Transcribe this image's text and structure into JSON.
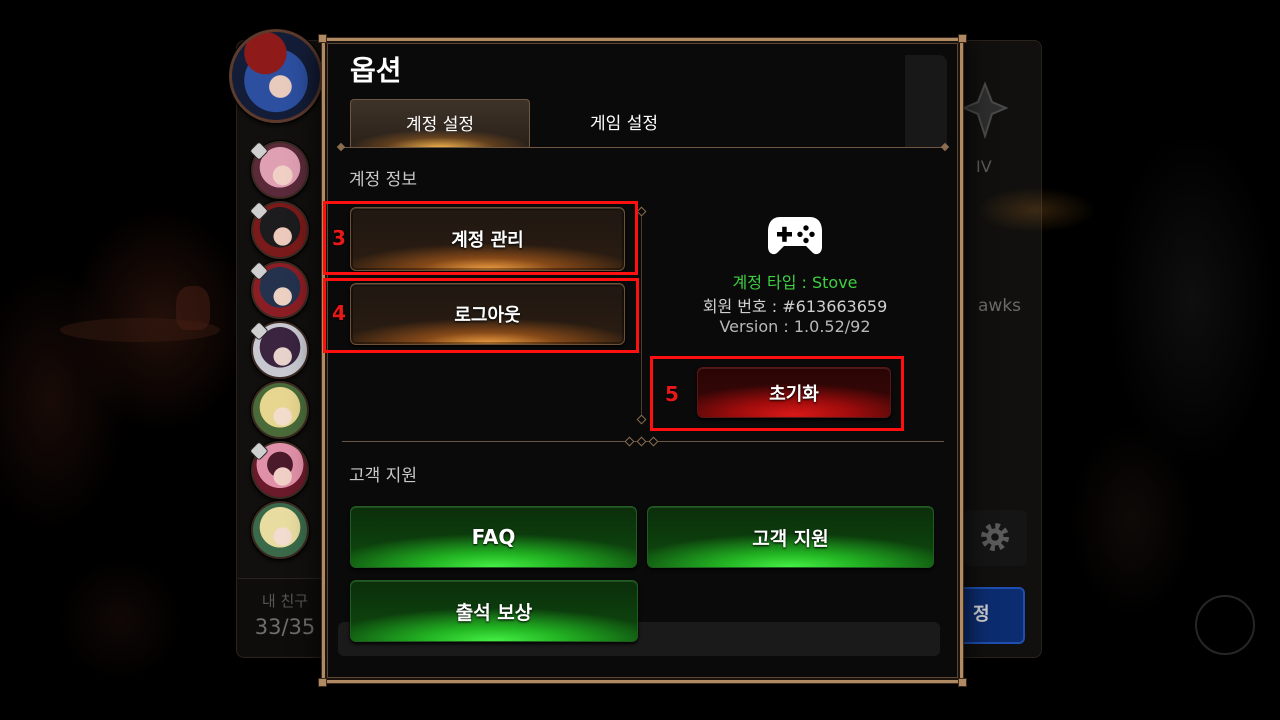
{
  "dialog": {
    "title": "옵션",
    "tabs": [
      {
        "label": "계정 설정",
        "active": true
      },
      {
        "label": "게임 설정",
        "active": false
      }
    ]
  },
  "account_info": {
    "section_label": "계정 정보",
    "manage_button": "계정 관리",
    "logout_button": "로그아웃",
    "platform_icon": "gamepad-icon",
    "account_type": "계정 타입 : Stove",
    "member_number": "회원 번호 : #613663659",
    "version": "Version : 1.0.52/92",
    "reset_button": "초기화"
  },
  "customer_support": {
    "section_label": "고객 지원",
    "faq_button": "FAQ",
    "support_button": "고객 지원",
    "attendance_button": "출석 보상"
  },
  "annotations": [
    "3",
    "4",
    "5"
  ],
  "background": {
    "friends_label": "내 친구",
    "friends_count": "33/35",
    "rank_text": "IV",
    "team_text": "awks",
    "settings_button_partial": "정",
    "settings_icon": "gear-icon"
  },
  "colors": {
    "frame": "#b08a62",
    "account_type_green": "#3fcf41",
    "annotation_red": "#ff1010",
    "primary_button_glow": "#ffaa46",
    "danger_button": "#d81818",
    "support_button": "#22b322"
  }
}
